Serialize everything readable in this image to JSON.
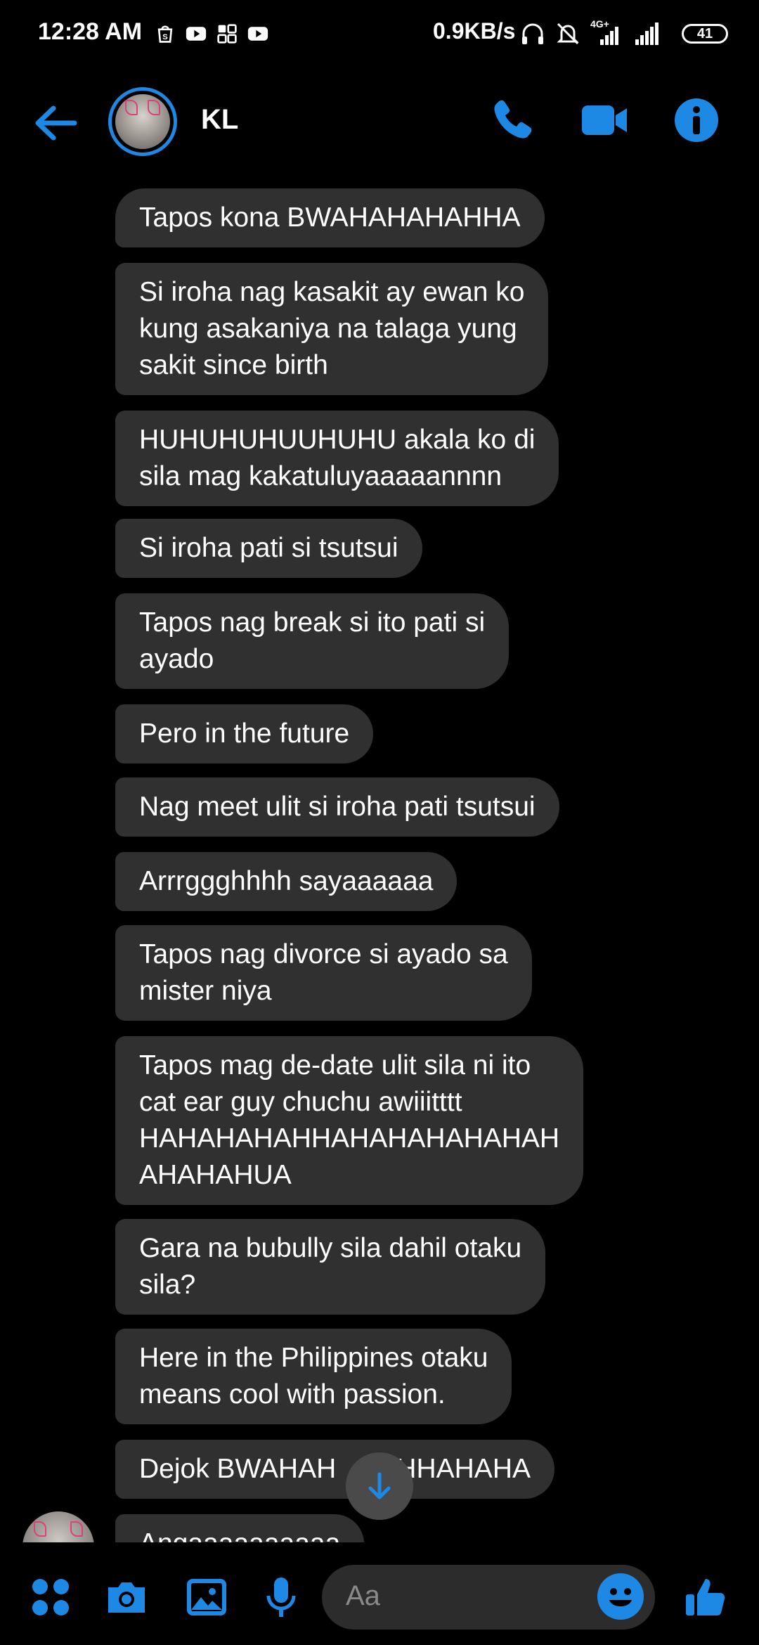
{
  "status_bar": {
    "time": "12:28 AM",
    "network_speed": "0.9KB/s",
    "network_type": "4G+",
    "battery": "41",
    "left_icons": [
      "shopee-icon",
      "youtube-icon",
      "apps-icon",
      "youtube-icon"
    ],
    "right_icons": [
      "headphones-icon",
      "mute-icon",
      "signal-icon",
      "signal-icon"
    ]
  },
  "header": {
    "contact_name": "KL",
    "back_icon": "arrow-left-icon",
    "actions": [
      "phone-icon",
      "video-camera-icon",
      "info-icon"
    ],
    "accent_color": "#1e88e5"
  },
  "messages": [
    {
      "lines": [
        "Tapos kona BWAHAHAHAHHA"
      ]
    },
    {
      "lines": [
        "Si iroha nag kasakit ay ewan ko",
        "kung asakaniya na talaga yung",
        "sakit since birth"
      ]
    },
    {
      "lines": [
        "HUHUHUHUUHUHU akala ko di",
        "sila mag kakatuluyaaaaannnn"
      ]
    },
    {
      "lines": [
        "Si iroha pati si tsutsui"
      ]
    },
    {
      "lines": [
        "Tapos nag break si ito pati si",
        "ayado"
      ]
    },
    {
      "lines": [
        "Pero in the future"
      ]
    },
    {
      "lines": [
        "Nag meet ulit si iroha pati tsutsui"
      ]
    },
    {
      "lines": [
        "Arrrggghhhh sayaaaaaa"
      ]
    },
    {
      "lines": [
        "Tapos nag divorce si ayado sa",
        "mister niya"
      ]
    },
    {
      "lines": [
        "Tapos mag de-date ulit sila ni ito",
        "cat ear guy chuchu awiiitttt",
        "HAHAHAHAHHAHAHAHAHAHAH",
        "AHAHAHUA"
      ]
    },
    {
      "lines": [
        "Gara na bubully sila dahil otaku",
        "sila?"
      ]
    },
    {
      "lines": [
        "Here in the Philippines otaku",
        "means cool with passion."
      ]
    },
    {
      "lines": [
        "Dejok BWAHAH",
        "AHHAHAHA"
      ]
    },
    {
      "lines": [
        "Angaaaaaaaaaa"
      ]
    }
  ],
  "composer": {
    "placeholder": "Aa",
    "icons": [
      "menu-dots-icon",
      "camera-icon",
      "gallery-icon",
      "microphone-icon",
      "emoji-icon",
      "like-icon"
    ]
  },
  "scroll_down_icon": "arrow-down-icon"
}
